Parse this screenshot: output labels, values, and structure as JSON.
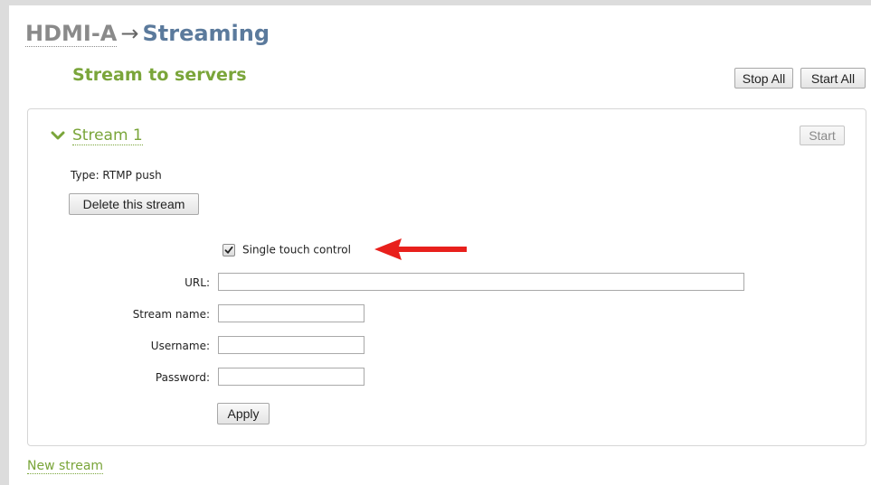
{
  "breadcrumb": {
    "parent": "HDMI-A",
    "separator": "→",
    "current": "Streaming"
  },
  "section": {
    "title": "Stream to servers",
    "stop_all_label": "Stop All",
    "start_all_label": "Start All"
  },
  "stream": {
    "name": "Stream 1",
    "start_label": "Start",
    "type_text": "Type: RTMP push",
    "delete_label": "Delete this stream",
    "single_touch": {
      "label": "Single touch control",
      "checked": true
    },
    "fields": {
      "url_label": "URL:",
      "url_value": "",
      "stream_name_label": "Stream name:",
      "stream_name_value": "",
      "username_label": "Username:",
      "username_value": "",
      "password_label": "Password:",
      "password_value": ""
    },
    "apply_label": "Apply"
  },
  "new_stream_label": "New stream",
  "colors": {
    "accent_green": "#7aa53a",
    "title_blue": "#5b7a9c",
    "annotation_arrow": "#e8201c"
  },
  "icons": {
    "expand": "chevron-down-icon",
    "checkbox": "checkmark-icon",
    "annotation": "red-arrow-icon"
  }
}
